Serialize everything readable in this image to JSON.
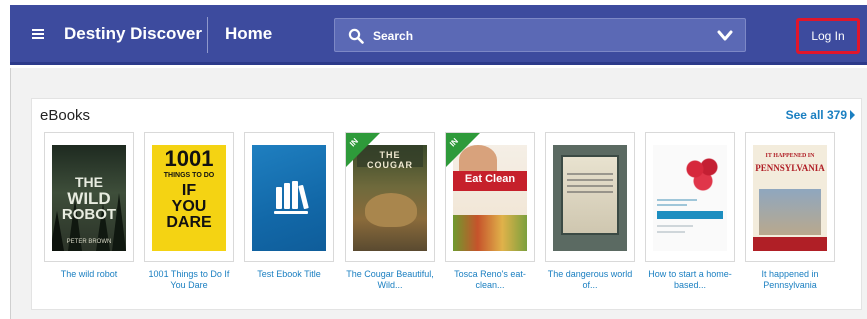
{
  "header": {
    "menu_icon": "hamburger-menu-icon",
    "brand": "Destiny Discover",
    "home_label": "Home",
    "search": {
      "placeholder": "Search",
      "icon": "search-icon",
      "dropdown_icon": "chevron-down-icon"
    },
    "login_label": "Log In",
    "colors": {
      "bar": "#3d4b9e",
      "search_bg": "#5b69b5",
      "highlight": "#e0162b"
    }
  },
  "section": {
    "title": "eBooks",
    "see_all_label": "See all 379",
    "books": [
      {
        "title": "The wild robot",
        "cover_text": [
          "THE",
          "WILD",
          "ROBOT"
        ],
        "cover_author": "PETER BROWN",
        "badge": ""
      },
      {
        "title": "1001 Things to Do If You Dare",
        "cover_text": [
          "1001",
          "THINGS TO DO",
          "IF",
          "YOU",
          "DARE"
        ],
        "badge": ""
      },
      {
        "title": "Test Ebook Title",
        "badge": ""
      },
      {
        "title": "The Cougar Beautiful, Wild...",
        "cover_text": [
          "THE COUGAR"
        ],
        "badge": "IN"
      },
      {
        "title": "Tosca Reno's eat-clean...",
        "cover_text": [
          "Eat Clean"
        ],
        "badge": "IN"
      },
      {
        "title": "The dangerous world of...",
        "badge": ""
      },
      {
        "title": "How to start a home-based...",
        "badge": ""
      },
      {
        "title": "It happened in Pennsylvania",
        "cover_text": [
          "IT HAPPENED IN",
          "PENNSYLVANIA"
        ],
        "badge": ""
      }
    ],
    "colors": {
      "link": "#1a7fc1",
      "badge_green": "#2e9a3a"
    }
  }
}
